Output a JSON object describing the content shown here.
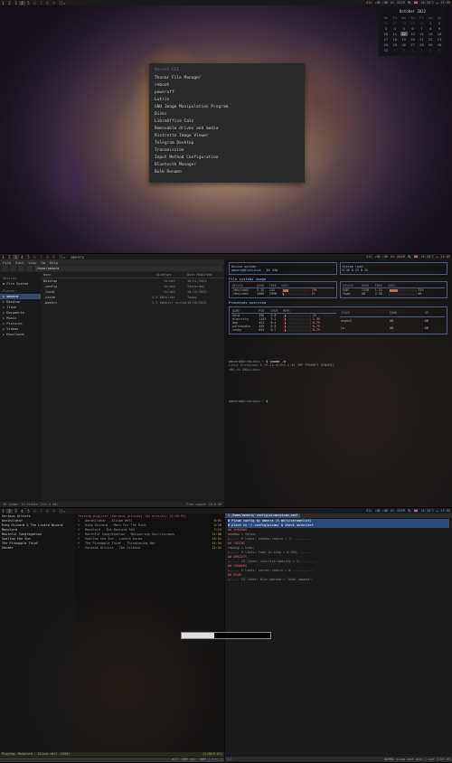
{
  "topbar": {
    "tags": [
      "1",
      "2",
      "3",
      "4",
      "5",
      "6",
      "7",
      "8",
      "9"
    ],
    "layout": "[]=",
    "status": {
      "vol": "41%",
      "net": "↓0B ↑0B",
      "cpu": "0%",
      "mem": "642M",
      "bat": "🔌",
      "kb": "🇬🇧",
      "temp": "18.20°C ☁",
      "time": "15:09"
    }
  },
  "screen1": {
    "active_tag": 4,
    "launcher": {
      "header": "Recent CLI",
      "items": [
        "Thunar File Manager",
        "reboot",
        "poweroff",
        "Lutris",
        "GNU Image Manipulation Program",
        "Disks",
        "LibreOffice Calc",
        "Removable drives and media",
        "Ristretto Image Viewer",
        "Telegram Desktop",
        "Transmission",
        "Input Method Configuration",
        "Bluetooth Manager",
        "Bulk Rename"
      ]
    },
    "calendar": {
      "title": "October 2022",
      "dow": [
        "Mo",
        "Tu",
        "We",
        "Th",
        "Fr",
        "Sa",
        "Su"
      ],
      "leading": [
        26,
        27,
        28,
        29,
        30
      ],
      "days": 31,
      "today": 12,
      "trailing": [
        1,
        2,
        3,
        4,
        5,
        6
      ]
    }
  },
  "screen2": {
    "active_tag": 3,
    "title_left": "omnera",
    "filemanager": {
      "menus": [
        "File",
        "Edit",
        "View",
        "Go",
        "Help"
      ],
      "path": "/home/omnera",
      "sidebar": {
        "devices_hdr": "Devices",
        "devices": [
          "File System"
        ],
        "places_hdr": "Places",
        "places": [
          "omnera",
          "Desktop",
          "Trash",
          "Documents",
          "Music",
          "Pictures",
          "Videos",
          "Downloads"
        ],
        "selected": "omnera"
      },
      "columns": [
        "Name",
        "Size",
        "Type",
        "Date Modified"
      ],
      "rows": [
        {
          "name": "Desktop",
          "size": "",
          "type": "folder",
          "date": "10/11/2022"
        },
        {
          "name": ".config",
          "size": "",
          "type": "folder",
          "date": "Yesterday"
        },
        {
          "name": ".local",
          "size": "",
          "type": "folder",
          "date": "10/10/2022"
        },
        {
          "name": ".cache",
          "size": "4.0 kB",
          "type": "folder",
          "date": "Today"
        },
        {
          "name": ".bashrc",
          "size": "3.9 kB",
          "type": "shell script",
          "date": "10/10/2022"
        }
      ],
      "status_left": "16 items: 14 hidden (141.4 kB)",
      "status_right": "Free space: 24.0 GB"
    },
    "sysmon": {
      "host_box": {
        "label1": "Device uptime:",
        "label2": "System load:",
        "user": "omnera@ArchLinux",
        "uptime": "6h 34m",
        "load": "0.36 0.23 0.34"
      },
      "fs_title": "File systems usage",
      "fs_cols": [
        "DEVICE",
        "USED",
        "FREE",
        "USE%"
      ],
      "fs": [
        {
          "dev": "/dev/sda3",
          "used": "5.3G",
          "free": "24G",
          "pct": 19
        },
        {
          "dev": "/dev/sda1",
          "used": "268K",
          "free": "299M",
          "pct": 1
        }
      ],
      "mem_title": "Memory usage",
      "mem_cols": [
        "DEVICE",
        "USED",
        "FREE",
        "USE%"
      ],
      "mem": [
        {
          "dev": "RAM",
          "used": "733M",
          "free": "1.1G",
          "pct": 31
        },
        {
          "dev": "Swap",
          "used": "0B",
          "free": "2.3G",
          "pct": 0
        }
      ],
      "proc_title": "Processes overview",
      "proc_cols": [
        "NAME",
        "PID",
        "CPU%",
        "MEM%"
      ],
      "procs": [
        {
          "name": "Xorg",
          "pid": 398,
          "cpu": 2.0,
          "mem": 3.8
        },
        {
          "name": "alacritty",
          "pid": 1151,
          "cpu": 1.3,
          "mem": 3.2
        },
        {
          "name": "dwm",
          "pid": 423,
          "cpu": 0.7,
          "mem": 0.4
        },
        {
          "name": "pulseaudio",
          "pid": 449,
          "cpu": 0.7,
          "mem": 0.5
        },
        {
          "name": "conky",
          "pid": 854,
          "cpu": 0.7,
          "mem": 0.7
        }
      ],
      "net_title": "Network overview",
      "net_cols": [
        "IFACE",
        "DOWN",
        "UP"
      ],
      "net": [
        {
          "if": "enp0s3",
          "dn": "0B",
          "up": "0B"
        },
        {
          "if": "lo",
          "dn": "0B",
          "up": "0B"
        }
      ],
      "term_prompt": "omnera@ArchLinux ~",
      "term_cmd": "uname -a",
      "term_out": [
        "Linux ArchLinux 5.19.13-arch1-1 #1 SMP PREEMPT_DYNAMIC",
        "x86_64 GNU/Linux"
      ],
      "term_prompt2": "omnera@ArchLinux ~",
      "term_cursor": "$"
    }
  },
  "screen3": {
    "active_tag": 2,
    "progress_pct": 37,
    "music": {
      "artists": [
        "Various Artists",
        "Annihilator",
        "King Gizzard & The Lizard Wizard",
        "Monolord",
        "Mournful Congregation",
        "Swallow the Sun",
        "The Pineapple Thief",
        "Xandar"
      ],
      "album": "Testing playlist (Various Artists) (by artists) [1:58:59]",
      "tracks": [
        {
          "n": 1,
          "t": "Annihilator - Alison Hell",
          "d": "5:01"
        },
        {
          "n": 2,
          "t": "King Gizzard - Mars For The Rich",
          "d": "4:18"
        },
        {
          "n": 3,
          "t": "Monolord - The Bastard Son",
          "d": "7:13"
        },
        {
          "n": 4,
          "t": "Mournful Congregation - Whispering Spiritscapes",
          "d": "11:36"
        },
        {
          "n": 5,
          "t": "Swallow the Sun - Lumina Aurea",
          "d": "13:51"
        },
        {
          "n": 6,
          "t": "The Pineapple Thief - Threatening War",
          "d": "11:34"
        },
        {
          "n": 7,
          "t": "Various Artists - The Silence",
          "d": "12:42"
        }
      ],
      "now_playing": "Playing: Monolord - Alison Hell (1999)",
      "time": "[1:50/5:01]",
      "footer": "all: 100% vol: 100% [-z-c--]"
    },
    "editor": {
      "tabs": [
        "1 /home/omnera/.config/picom/picom.conf"
      ],
      "active_tab": 0,
      "lines": [
        {
          "cls": "hl",
          "txt": "# Picom config by omnera (t.me/s/xeromelist)"
        },
        {
          "cls": "hl",
          "txt": "# place in ~/.config/picom/ & check autostart"
        },
        {
          "cls": "cmt",
          "txt": "## SHADOWS"
        },
        {
          "cls": "norm",
          "txt": "shadow = false;"
        },
        {
          "cls": "fold",
          "txt": "+-----  9 lines: shadow-radius = 7; ----------"
        },
        {
          "cls": "cmt",
          "txt": "## FADING"
        },
        {
          "cls": "norm",
          "txt": "fading = true;"
        },
        {
          "cls": "fold",
          "txt": "+-----  5 lines: fade-in-step = 0.056; -------"
        },
        {
          "cls": "cmt",
          "txt": "## OPACITY"
        },
        {
          "cls": "fold",
          "txt": "+----- 15 lines: inactive-opacity = 1; -------"
        },
        {
          "cls": "cmt",
          "txt": "## CORNERS"
        },
        {
          "cls": "fold",
          "txt": "+-----  5 lines: corner-radius = 0 -----------"
        },
        {
          "cls": "cmt",
          "txt": "## BLUR"
        },
        {
          "cls": "fold",
          "txt": "+----- 13 lines: blur-method = \"dual_kawase\";"
        }
      ],
      "status_left": "1:1",
      "status_right": "NORMAL  picom.conf  unix | conf  1/107  0%"
    }
  }
}
